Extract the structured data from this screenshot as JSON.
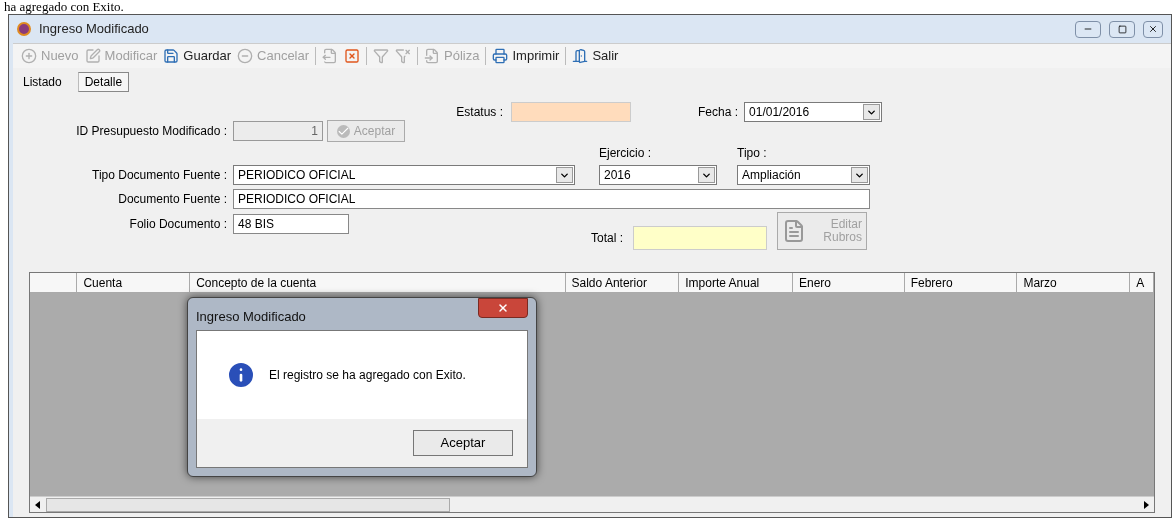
{
  "document_text": "ha agregado con Exito.",
  "window": {
    "title": "Ingreso Modificado"
  },
  "toolbar": [
    {
      "kind": "button",
      "label": "Nuevo",
      "disabled": true
    },
    {
      "kind": "button",
      "label": "Modificar",
      "disabled": true
    },
    {
      "kind": "button",
      "label": "Guardar",
      "disabled": false
    },
    {
      "kind": "button",
      "label": "Cancelar",
      "disabled": true
    },
    {
      "kind": "separator"
    },
    {
      "kind": "icon",
      "disabled": true
    },
    {
      "kind": "icon",
      "disabled": false
    },
    {
      "kind": "separator"
    },
    {
      "kind": "icon",
      "disabled": true
    },
    {
      "kind": "icon",
      "disabled": true
    },
    {
      "kind": "separator"
    },
    {
      "kind": "button",
      "label": "Póliza",
      "disabled": true
    },
    {
      "kind": "separator"
    },
    {
      "kind": "button",
      "label": "Imprimir",
      "disabled": false
    },
    {
      "kind": "separator"
    },
    {
      "kind": "button",
      "label": "Salir",
      "disabled": false
    }
  ],
  "tabs": [
    {
      "label": "Listado",
      "selected": false
    },
    {
      "label": "Detalle",
      "selected": true
    }
  ],
  "form": {
    "estatus": {
      "label": "Estatus :"
    },
    "fecha": {
      "label": "Fecha :",
      "value": "01/01/2016"
    },
    "id": {
      "label": "ID Presupuesto Modificado :",
      "value": "1",
      "disabled": true
    },
    "aceptar": {
      "label": "Aceptar",
      "disabled": true
    },
    "tipo_documento_fuente": {
      "label": "Tipo Documento Fuente :",
      "value": "PERIODICO OFICIAL"
    },
    "ejercicio": {
      "label": "Ejercicio :",
      "value": "2016"
    },
    "tipo": {
      "label": "Tipo :",
      "value": "Ampliación"
    },
    "documento_fuente": {
      "label": "Documento Fuente :",
      "value": "PERIODICO OFICIAL"
    },
    "folio_documento": {
      "label": "Folio Documento :",
      "value": "48 BIS"
    },
    "total": {
      "label": "Total :"
    },
    "editar_rubros": {
      "label": "Editar Rubros",
      "disabled": true
    }
  },
  "grid": {
    "columns": [
      "Cuenta",
      "Concepto de la cuenta",
      "Saldo Anterior",
      "Importe Anual",
      "Enero",
      "Febrero",
      "Marzo",
      "A"
    ]
  },
  "dialog": {
    "title": "Ingreso Modificado",
    "message": "El registro se ha agregado con Exito.",
    "button": "Aceptar"
  }
}
